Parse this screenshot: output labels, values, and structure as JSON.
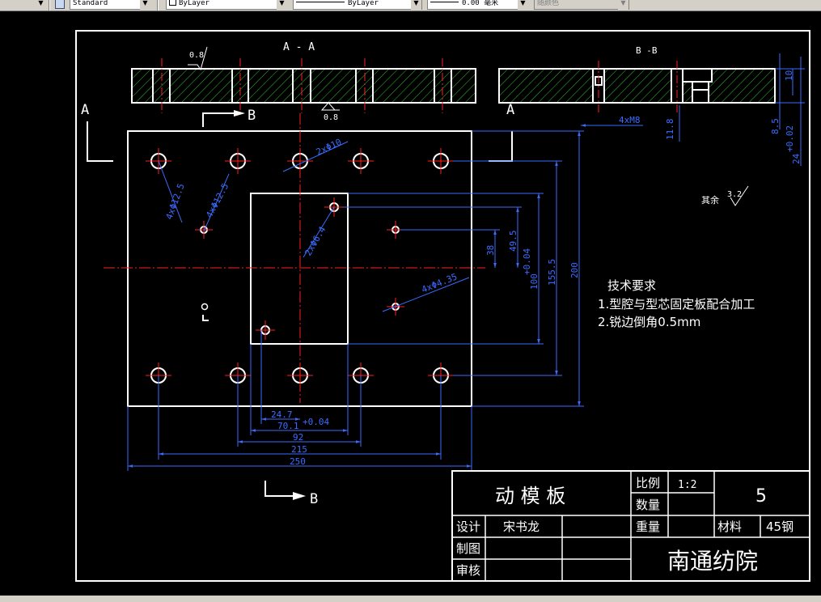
{
  "toolbar": {
    "text_style": "Standard",
    "layer": "ByLayer",
    "linetype": "ByLayer",
    "lineweight": "0.00 毫米",
    "color": "随颜色"
  },
  "drawing": {
    "sections": {
      "aa_label": "A - A",
      "bb_label": "B -B",
      "roughness_top": "0.8",
      "roughness_bottom": "0.8"
    },
    "markers": {
      "a_left": "A",
      "a_right": "A",
      "b_top": "B",
      "b_bottom": "B"
    },
    "dimensions": {
      "hole_2x10": "2xΦ10",
      "hole_4x12_5": "4xΦ12.5",
      "hole_4x12_5b": "4xΦ12.5",
      "hole_2x6_4": "2xΦ6.4",
      "hole_4x4_35": "4xΦ4.35",
      "d_200": "200",
      "d_155_5": "155.5",
      "d_100": "100",
      "d_100_tol": "+0.04",
      "d_38": "38",
      "d_49_5": "49.5",
      "d_24_7": "24.7",
      "d_70": "70.1",
      "d_70_tol": "+0.04",
      "d_92": "92",
      "d_215": "215",
      "d_250": "250",
      "d_4xm8": "4xM8",
      "d_11_8": "11.8",
      "d_8_5": "8.5",
      "d_24": "24",
      "d_24_tol": "+0.02",
      "d_10": "10"
    },
    "other_roughness": {
      "label": "其余",
      "value": "3.2"
    },
    "technical_requirements": {
      "title": "技术要求",
      "items": [
        "1.型腔与型芯固定板配合加工",
        "2.锐边倒角0.5mm"
      ]
    },
    "title_block": {
      "part_name": "动 模 板",
      "scale_label": "比例",
      "scale_value": "1:2",
      "quantity_label": "数量",
      "sheet_number": "5",
      "weight_label": "重量",
      "material_label": "材料",
      "material_value": "45钢",
      "design_label": "设计",
      "designer": "宋书龙",
      "drawn_label": "制图",
      "checked_label": "审核",
      "institution": "南通纺院"
    }
  },
  "colors": {
    "background": "#000000",
    "outline": "#ffffff",
    "dimension": "#3b6cff",
    "centerline": "#ff2020",
    "hatch": "#2fbf2f"
  }
}
